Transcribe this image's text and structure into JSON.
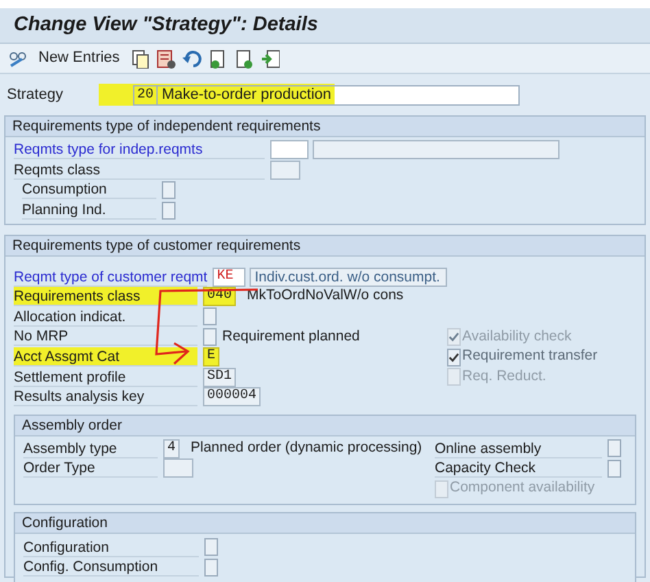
{
  "window": {
    "title": "Change View \"Strategy\": Details"
  },
  "toolbar": {
    "new_entries": "New Entries"
  },
  "strategy": {
    "label": "Strategy",
    "value": "20",
    "description": "Make-to-order production",
    "highlighted": true
  },
  "independent": {
    "title": "Requirements type of independent requirements",
    "rows": [
      {
        "kind": "type",
        "label": "Reqmts type for indep.reqmts",
        "link": true,
        "value": "",
        "description": ""
      },
      {
        "kind": "code",
        "label": "Reqmts class",
        "value": ""
      },
      {
        "kind": "checkbox",
        "label": "Consumption",
        "checked": false,
        "indented": true
      },
      {
        "kind": "checkbox",
        "label": "Planning Ind.",
        "checked": false,
        "indented": true
      }
    ]
  },
  "customer": {
    "title": "Requirements type of customer requirements",
    "rows": [
      {
        "kind": "type",
        "label": "Reqmt type of customer reqmt",
        "link": true,
        "value": "KE",
        "description": "Indiv.cust.ord. w/o consumpt."
      },
      {
        "kind": "code",
        "label": "Requirements class",
        "value": "040",
        "text": "MkToOrdNoValW/o cons",
        "highlighted": true
      },
      {
        "kind": "checkbox",
        "label": "Allocation indicat.",
        "checked": false
      },
      {
        "kind": "checkbox",
        "label": "No MRP",
        "checked": false,
        "text": "Requirement planned",
        "side": {
          "label": "Availability check",
          "checked": true,
          "disabled": true
        }
      },
      {
        "kind": "code",
        "label": "Acct Assgmt Cat",
        "value": "E",
        "highlighted": true,
        "side": {
          "label": "Requirement transfer",
          "checked": true,
          "disabled": false
        }
      },
      {
        "kind": "code",
        "label": "Settlement profile",
        "value": "SD1",
        "side": {
          "label": "Req. Reduct.",
          "checked": false,
          "disabled": true
        }
      },
      {
        "kind": "code",
        "label": "Results analysis key",
        "value": "000004"
      }
    ]
  },
  "assembly": {
    "title": "Assembly order",
    "rows": [
      {
        "kind": "code",
        "label": "Assembly type",
        "value": "4",
        "text": "Planned order (dynamic processing)",
        "side": {
          "label": "Online assembly",
          "checked": false,
          "disabled": false
        }
      },
      {
        "kind": "code",
        "label": "Order Type",
        "value": "",
        "side": {
          "label": "Capacity Check",
          "checked": false,
          "disabled": false
        }
      },
      {
        "kind": "blank",
        "side": {
          "label": "Component availability",
          "checked": false,
          "disabled": true
        }
      }
    ]
  },
  "configuration": {
    "title": "Configuration",
    "rows": [
      {
        "kind": "checkbox",
        "label": "Configuration",
        "checked": false
      },
      {
        "kind": "checkbox",
        "label": "Config. Consumption",
        "checked": false
      }
    ]
  }
}
